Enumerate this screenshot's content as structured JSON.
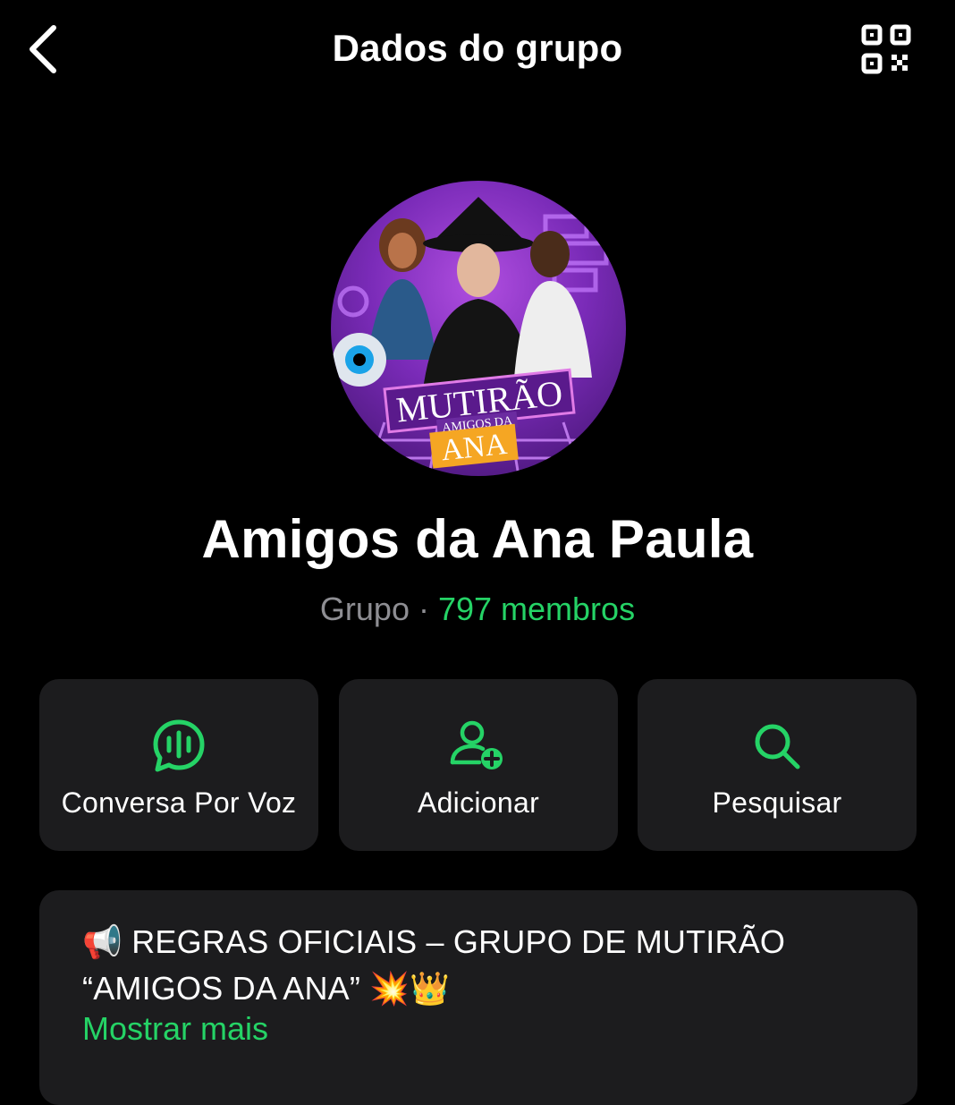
{
  "header": {
    "back_label": "Back",
    "title": "Dados do grupo",
    "qr_icon": "qr-code-icon"
  },
  "group": {
    "avatar_text": {
      "line1": "MUTIRÃO",
      "line2": "AMIGOS DA",
      "line3": "ANA"
    },
    "name": "Amigos da Ana Paula",
    "kind": "Grupo",
    "separator": "·",
    "members": "797 membros"
  },
  "actions": [
    {
      "label": "Conversa Por Voz",
      "icon": "voice-chat-icon"
    },
    {
      "label": "Adicionar",
      "icon": "add-person-icon"
    },
    {
      "label": "Pesquisar",
      "icon": "search-icon"
    }
  ],
  "description": {
    "line1": "📢 REGRAS OFICIAIS – GRUPO DE MUTIRÃO",
    "line2": "“AMIGOS DA ANA” 💥👑",
    "show_more": "Mostrar mais"
  },
  "colors": {
    "background": "#000000",
    "card": "#1c1c1e",
    "accent": "#25d366",
    "secondary_text": "#8e8e93"
  }
}
